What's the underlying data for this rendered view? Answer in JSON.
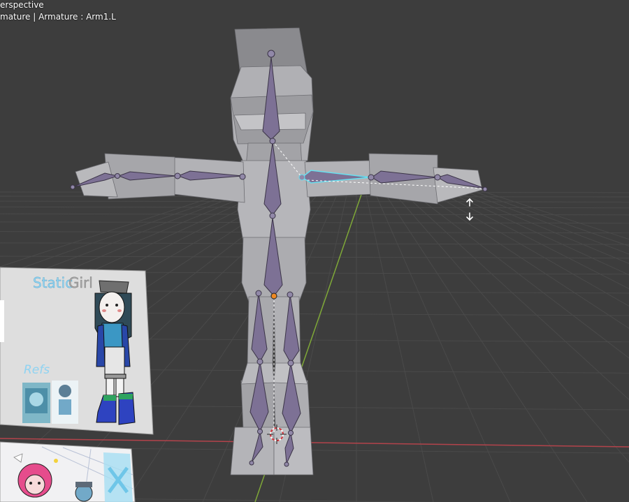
{
  "overlay": {
    "view_label": "erspective",
    "status_label": "mature | Armature : Arm1.L"
  },
  "reference_sheet": {
    "title_word_1": "Static",
    "title_word_2": "Girl",
    "refs_label": "Refs"
  },
  "colors": {
    "viewport_bg": "#3d3d3d",
    "grid_line": "#4a4a4a",
    "axis_x": "#b3434b",
    "axis_y": "#7fa838",
    "mesh_light": "#b8b8bb",
    "mesh_mid": "#a4a4a8",
    "mesh_dark": "#8e8e93",
    "bone_fill": "#7d7195",
    "bone_stroke": "#3b3447",
    "bone_selected": "#67e0f0",
    "joint": "#9188a8",
    "origin": "#f08a24",
    "title_blue": "#8fd3f2",
    "title_gray": "#a7a7a7"
  },
  "icons": {
    "move_cursor": "vertical-move-cursor-icon",
    "cursor_3d": "3d-cursor-icon"
  }
}
